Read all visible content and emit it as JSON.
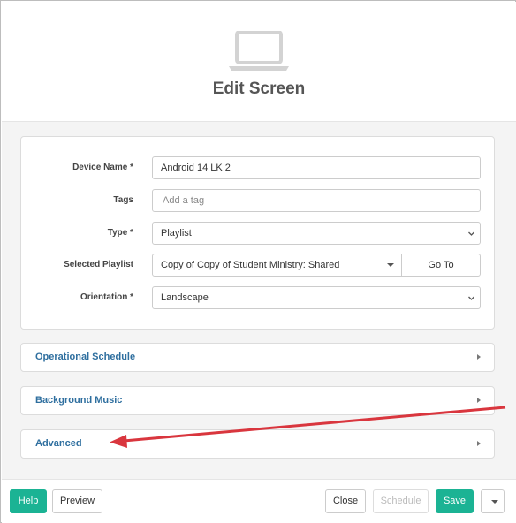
{
  "header": {
    "icon": "laptop-icon",
    "title": "Edit Screen"
  },
  "form": {
    "device_name": {
      "label": "Device Name *",
      "value": "Android 14 LK 2"
    },
    "tags": {
      "label": "Tags",
      "placeholder": "Add a tag"
    },
    "type": {
      "label": "Type *",
      "value": "Playlist"
    },
    "selected_playlist": {
      "label": "Selected Playlist",
      "value": "Copy of Copy of Student Ministry: Shared",
      "goto_label": "Go To"
    },
    "orientation": {
      "label": "Orientation *",
      "value": "Landscape"
    }
  },
  "panels": [
    {
      "title": "Operational Schedule"
    },
    {
      "title": "Background Music"
    },
    {
      "title": "Advanced"
    }
  ],
  "footer": {
    "help_label": "Help",
    "preview_label": "Preview",
    "close_label": "Close",
    "schedule_label": "Schedule",
    "save_label": "Save"
  },
  "colors": {
    "accent_green": "#1bb394",
    "panel_title_blue": "#2f6f9f",
    "annotation_arrow": "#d9363e"
  }
}
